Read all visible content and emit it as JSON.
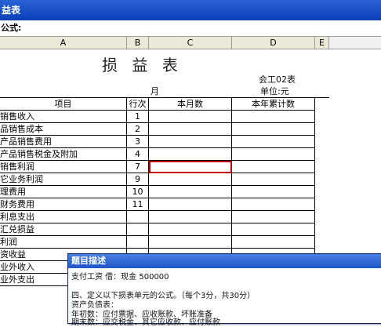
{
  "window": {
    "title": "益表"
  },
  "formula_bar": {
    "label": "公式:",
    "value": ""
  },
  "columns": [
    "A",
    "B",
    "C",
    "D",
    "E"
  ],
  "sheet": {
    "title": "损 益 表",
    "form_code": "会工02表",
    "unit": "单位:元",
    "month_label": "月",
    "headers": {
      "item": "项目",
      "line": "行次",
      "current": "本月数",
      "ytd": "本年累计数"
    },
    "rows": [
      {
        "item": "销售收入",
        "line": "1"
      },
      {
        "item": "品销售成本",
        "line": "2"
      },
      {
        "item": "产品销售费用",
        "line": "3"
      },
      {
        "item": "产品销售税金及附加",
        "line": "4"
      },
      {
        "item": "销售利润",
        "line": "7"
      },
      {
        "item": "它业务利润",
        "line": "9"
      },
      {
        "item": "理费用",
        "line": "10"
      },
      {
        "item": "财务费用",
        "line": "11"
      },
      {
        "item": "利息支出",
        "line": ""
      },
      {
        "item": "汇兑损益",
        "line": ""
      },
      {
        "item": "利润",
        "line": ""
      },
      {
        "item": "资收益",
        "line": ""
      },
      {
        "item": "业外收入",
        "line": ""
      },
      {
        "item": "业外支出",
        "line": ""
      }
    ]
  },
  "dialog": {
    "title": "题目描述",
    "line1": "支付工资     借：现金                              500000",
    "line2": "四、定义以下损表单元的公式。（每个3分，共30分）",
    "line3": "资产负债表：",
    "line4": "年初数：应付票据、应收账款、坏账准备",
    "line5": "期末数：应交税金、其它应收款、应付账款"
  }
}
